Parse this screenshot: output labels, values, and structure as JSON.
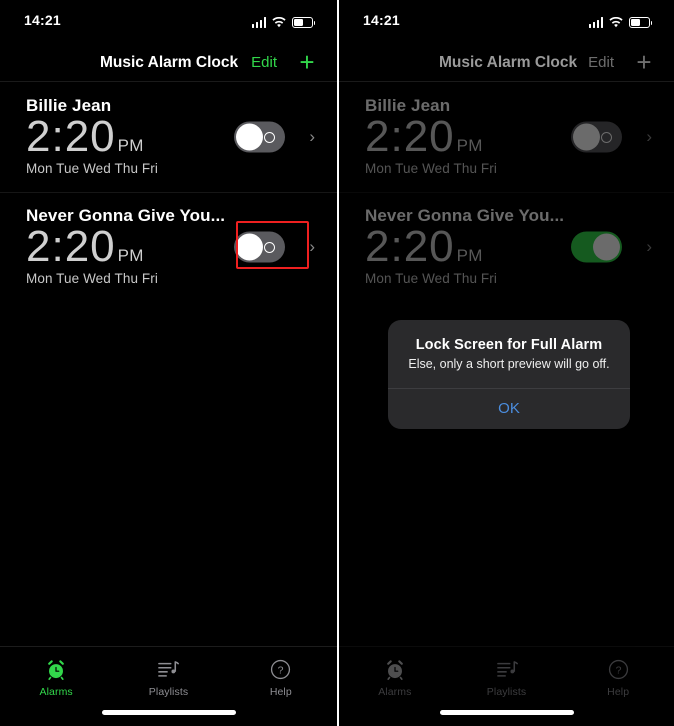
{
  "statusbar": {
    "time": "14:21",
    "signal_icon": "cellular-signal-icon",
    "wifi_icon": "wifi-icon",
    "battery_icon": "battery-icon",
    "battery_level_percent": 52
  },
  "navbar": {
    "title": "Music Alarm Clock",
    "edit_label": "Edit",
    "add_label": "+",
    "accent_color": "#32d74b",
    "dimmed_title_color": "#9a9a9a"
  },
  "alarms": [
    {
      "name": "Billie Jean",
      "time": "2:20",
      "meridiem": "PM",
      "days": "Mon Tue Wed Thu Fri",
      "enabled_left": false,
      "enabled_right": false,
      "chevron": "›"
    },
    {
      "name": "Never Gonna Give You...",
      "time": "2:20",
      "meridiem": "PM",
      "days": "Mon Tue Wed Thu Fri",
      "enabled_left": false,
      "enabled_right": true,
      "chevron": "›"
    }
  ],
  "highlight": {
    "color": "#ef2020",
    "target": "second-alarm-toggle"
  },
  "tabbar": {
    "items": [
      {
        "label": "Alarms",
        "icon": "alarm-clock-icon",
        "active": true
      },
      {
        "label": "Playlists",
        "icon": "playlist-music-icon",
        "active": false
      },
      {
        "label": "Help",
        "icon": "question-mark-circle-icon",
        "active": false
      }
    ],
    "active_color": "#32d74b",
    "inactive_color": "#8e8e93"
  },
  "alert": {
    "title": "Lock Screen for Full Alarm",
    "message": "Else, only a short preview will go off.",
    "ok_label": "OK",
    "ok_color": "#4b8dde",
    "background": "#2a2a2c"
  },
  "panels": {
    "left_name": "before-state",
    "right_name": "after-state-with-alert"
  }
}
